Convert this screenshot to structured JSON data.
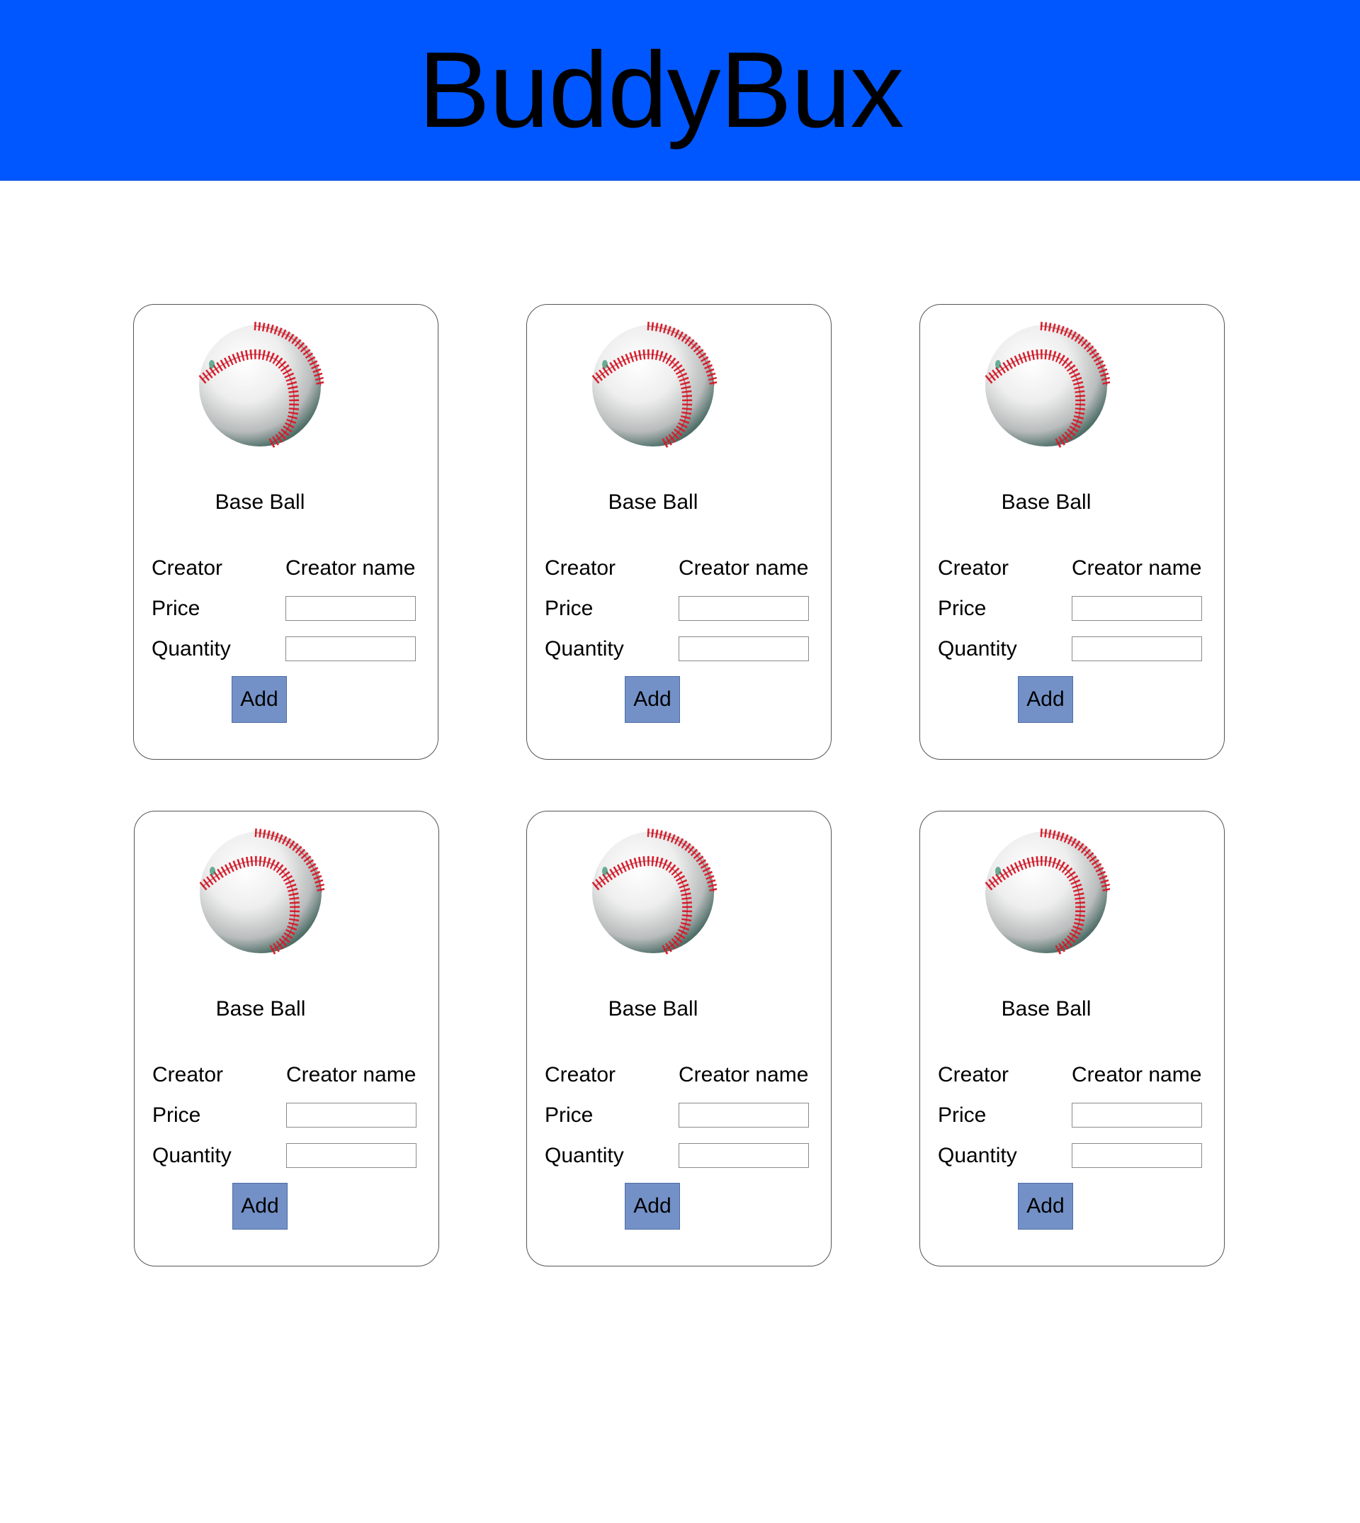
{
  "header": {
    "title": "BuddyBux"
  },
  "colors": {
    "header_bg": "#0057ff",
    "button_bg": "#7391c7",
    "stitch": "#d8202f"
  },
  "product_image_icon": "baseball-icon",
  "cards": [
    {
      "name": "Base Ball",
      "creator_label": "Creator",
      "creator_value": "Creator name",
      "price_label": "Price",
      "price_value": "",
      "quantity_label": "Quantity",
      "quantity_value": "",
      "add_label": "Add"
    },
    {
      "name": "Base Ball",
      "creator_label": "Creator",
      "creator_value": "Creator name",
      "price_label": "Price",
      "price_value": "",
      "quantity_label": "Quantity",
      "quantity_value": "",
      "add_label": "Add"
    },
    {
      "name": "Base Ball",
      "creator_label": "Creator",
      "creator_value": "Creator name",
      "price_label": "Price",
      "price_value": "",
      "quantity_label": "Quantity",
      "quantity_value": "",
      "add_label": "Add"
    },
    {
      "name": "Base Ball",
      "creator_label": "Creator",
      "creator_value": "Creator name",
      "price_label": "Price",
      "price_value": "",
      "quantity_label": "Quantity",
      "quantity_value": "",
      "add_label": "Add"
    },
    {
      "name": "Base Ball",
      "creator_label": "Creator",
      "creator_value": "Creator name",
      "price_label": "Price",
      "price_value": "",
      "quantity_label": "Quantity",
      "quantity_value": "",
      "add_label": "Add"
    },
    {
      "name": "Base Ball",
      "creator_label": "Creator",
      "creator_value": "Creator name",
      "price_label": "Price",
      "price_value": "",
      "quantity_label": "Quantity",
      "quantity_value": "",
      "add_label": "Add"
    }
  ]
}
